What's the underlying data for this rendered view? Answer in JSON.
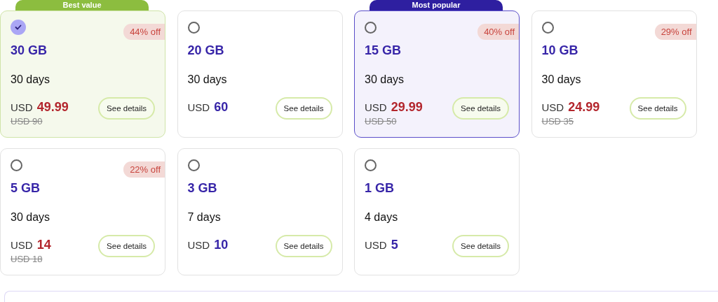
{
  "plans": [
    {
      "data": "30 GB",
      "days": "30 days",
      "currency": "USD",
      "price": "49.99",
      "old_price": "USD 90",
      "discount": "44% off",
      "banner": "Best value",
      "kind": "value",
      "selected": true,
      "details": "See details"
    },
    {
      "data": "20 GB",
      "days": "30 days",
      "currency": "USD",
      "price": "60",
      "kind": "plain",
      "selected": false,
      "details": "See details"
    },
    {
      "data": "15 GB",
      "days": "30 days",
      "currency": "USD",
      "price": "29.99",
      "old_price": "USD 50",
      "discount": "40% off",
      "banner": "Most popular",
      "kind": "popular",
      "selected": false,
      "details": "See details"
    },
    {
      "data": "10 GB",
      "days": "30 days",
      "currency": "USD",
      "price": "24.99",
      "old_price": "USD 35",
      "discount": "29% off",
      "kind": "plain",
      "selected": false,
      "details": "See details"
    },
    {
      "data": "5 GB",
      "days": "30 days",
      "currency": "USD",
      "price": "14",
      "old_price": "USD 18",
      "discount": "22% off",
      "kind": "plain",
      "selected": false,
      "details": "See details"
    },
    {
      "data": "3 GB",
      "days": "7 days",
      "currency": "USD",
      "price": "10",
      "kind": "plain",
      "selected": false,
      "details": "See details"
    },
    {
      "data": "1 GB",
      "days": "4 days",
      "currency": "USD",
      "price": "5",
      "kind": "plain",
      "selected": false,
      "details": "See details"
    }
  ]
}
